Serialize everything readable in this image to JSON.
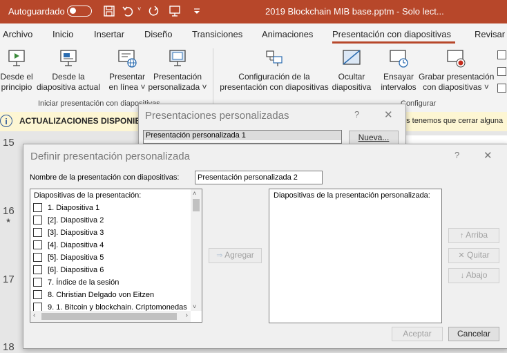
{
  "titlebar": {
    "autosave_label": "Autoguardado",
    "autosave_state": "off",
    "document_title": "2019 Blockchain MIB base.pptm  -  Solo lect..."
  },
  "menu": {
    "tabs": [
      "Archivo",
      "Inicio",
      "Insertar",
      "Diseño",
      "Transiciones",
      "Animaciones",
      "Presentación con diapositivas",
      "Revisar"
    ],
    "active": "Presentación con diapositivas"
  },
  "ribbon": {
    "buttons": {
      "from_start": [
        "Desde el",
        "principio"
      ],
      "from_current": [
        "Desde la",
        "diapositiva actual"
      ],
      "present_online": [
        "Presentar",
        "en línea ˅"
      ],
      "custom_show": [
        "Presentación",
        "personalizada ˅"
      ],
      "setup_show": [
        "Configuración de la",
        "presentación con diapositivas"
      ],
      "hide_slide": [
        "Ocultar",
        "diapositiva"
      ],
      "rehearse": [
        "Ensayar",
        "intervalos"
      ],
      "record": [
        "Grabar presentación",
        "con diapositivas ˅"
      ]
    },
    "groups": {
      "start": "Iniciar presentación con diapositivas",
      "configure": "Configurar"
    }
  },
  "infobar": {
    "title": "ACTUALIZACIONES DISPONIBL",
    "message_tail": "es tenemos que cerrar alguna"
  },
  "slides": {
    "numbers": [
      "15",
      "16",
      "17",
      "18"
    ],
    "star": "★"
  },
  "dialog_custom_shows": {
    "title": "Presentaciones personalizadas",
    "help": "?",
    "close": "✕",
    "items": [
      "Presentación personalizada 1"
    ],
    "new_button": "Nueva..."
  },
  "dialog_define": {
    "title": "Definir presentación personalizada",
    "help": "?",
    "close": "✕",
    "name_label": "Nombre de la presentación con diapositivas:",
    "name_value": "Presentación personalizada 2",
    "left_label": "Diapositivas de la presentación:",
    "right_label": "Diapositivas de la presentación personalizada:",
    "slides": [
      "1. Diapositiva 1",
      "[2]. Diapositiva 2",
      "[3]. Diapositiva 3",
      "[4]. Diapositiva 4",
      "[5]. Diapositiva 5",
      "[6]. Diapositiva 6",
      "7. Índice de la sesión",
      "8. Christian Delgado von Eitzen",
      "9. 1. Bitcoin y blockchain. Criptomonedas"
    ],
    "add_button": "Agregar",
    "up_button": "Arriba",
    "remove_button": "Quitar",
    "down_button": "Abajo",
    "accept_button": "Aceptar",
    "cancel_button": "Cancelar"
  }
}
